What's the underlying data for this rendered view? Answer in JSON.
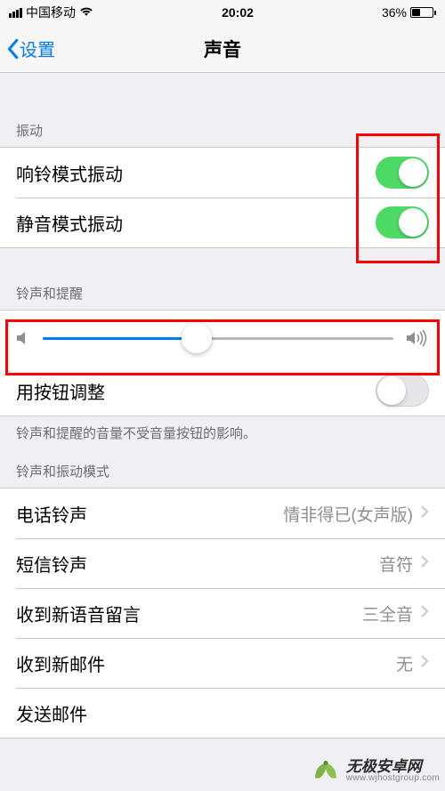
{
  "status": {
    "carrier": "中国移动",
    "time": "20:02",
    "battery_pct": "36%"
  },
  "nav": {
    "back_label": "设置",
    "title": "声音"
  },
  "section_vibration": {
    "header": "振动",
    "vibrate_on_ring": "响铃模式振动",
    "vibrate_on_silent": "静音模式振动"
  },
  "section_ringer": {
    "header": "铃声和提醒",
    "button_adjust": "用按钮调整",
    "footer": "铃声和提醒的音量不受音量按钮的影响。",
    "slider_value": 44
  },
  "section_patterns": {
    "header": "铃声和振动模式",
    "rows": [
      {
        "label": "电话铃声",
        "value": "情非得已(女声版)"
      },
      {
        "label": "短信铃声",
        "value": "音符"
      },
      {
        "label": "收到新语音留言",
        "value": "三全音"
      },
      {
        "label": "收到新邮件",
        "value": "无"
      },
      {
        "label": "发送邮件",
        "value": ""
      }
    ]
  },
  "watermark": {
    "cn": "无极安卓网",
    "en": "www.wjhostgroup.com"
  }
}
